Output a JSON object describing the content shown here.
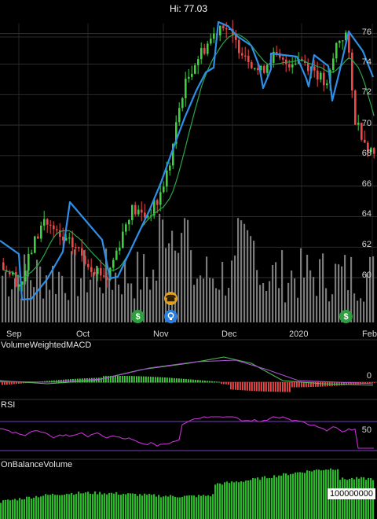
{
  "header": {
    "high_label": "Hi: 77.03"
  },
  "price_axis": {
    "ticks": [
      "76",
      "74",
      "72",
      "70",
      "68",
      "66",
      "64",
      "62",
      "60"
    ]
  },
  "time_axis": {
    "ticks": [
      "Sep",
      "Oct",
      "Nov",
      "Dec",
      "2020",
      "Feb"
    ]
  },
  "events": [
    {
      "icon": "dividend-dollar-icon",
      "glyph": "$",
      "color": "#2e9e3e"
    },
    {
      "icon": "earnings-phone-icon",
      "glyph": "☎",
      "color": "#e0a020"
    },
    {
      "icon": "info-bulb-icon",
      "glyph": "💡",
      "color": "#2a7fe0"
    },
    {
      "icon": "dividend-dollar-icon",
      "glyph": "$",
      "color": "#2e9e3e"
    },
    {
      "icon": "dividend-dollar-icon",
      "glyph": "$",
      "color": "#2e9e3e"
    }
  ],
  "indicators": {
    "macd": {
      "title": "VolumeWeightedMACD",
      "tick": "0"
    },
    "rsi": {
      "title": "RSI",
      "tick": "50"
    },
    "obv": {
      "title": "OnBalanceVolume",
      "value": "100000000"
    }
  },
  "colors": {
    "up": "#3fcf3f",
    "down": "#f04848",
    "band": "#2f8fe8",
    "ma": "#2aa64a",
    "rsi": "#c82fd8",
    "rsi_bounds": "#7a3fc0",
    "macd_line": "#4fbf4f",
    "signal_line": "#b050d8",
    "obv": "#28b828",
    "volume": "#7a7a7a"
  },
  "chart_data": {
    "type": "candlestick",
    "high": 77.03,
    "ylim": [
      59,
      77.5
    ],
    "x_ticks": [
      "Sep",
      "Oct",
      "Nov",
      "Dec",
      "2020",
      "Feb"
    ],
    "y_ticks": [
      60,
      62,
      64,
      66,
      68,
      70,
      72,
      74,
      76
    ]
  }
}
